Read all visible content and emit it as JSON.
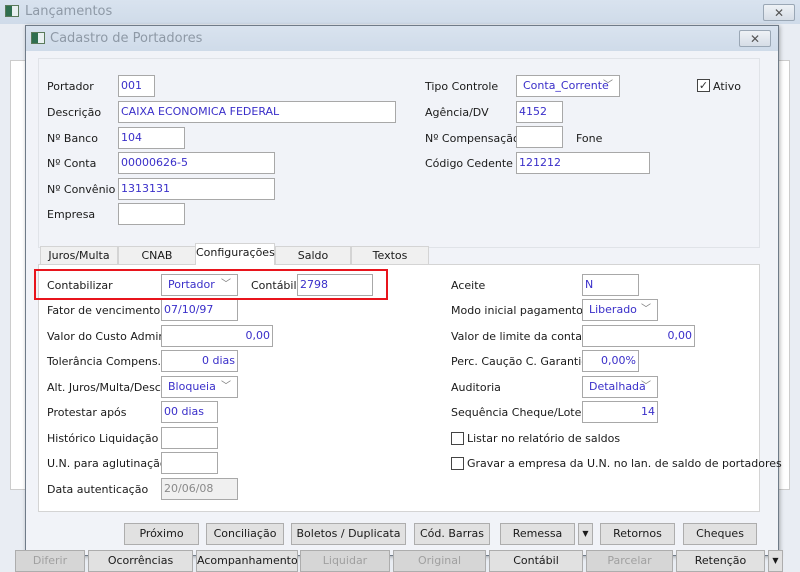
{
  "outer_window": {
    "title": "Lançamentos"
  },
  "dialog": {
    "title": "Cadastro de Portadores"
  },
  "header": {
    "portador": {
      "label": "Portador",
      "value": "001"
    },
    "descricao": {
      "label": "Descrição",
      "value": "CAIXA ECONOMICA FEDERAL"
    },
    "banco": {
      "label": "Nº Banco",
      "value": "104"
    },
    "conta": {
      "label": "Nº Conta",
      "value": "00000626-5"
    },
    "convenio": {
      "label": "Nº Convênio",
      "value": "1313131"
    },
    "empresa": {
      "label": "Empresa",
      "value": ""
    },
    "tipo_controle": {
      "label": "Tipo Controle",
      "value": "Conta_Corrente"
    },
    "agencia": {
      "label": "Agência/DV",
      "value": "4152"
    },
    "compensacao": {
      "label": "Nº Compensação",
      "value": ""
    },
    "fone": {
      "label": "Fone"
    },
    "cedente": {
      "label": "Código Cedente",
      "value": "121212"
    },
    "ativo": {
      "label": "Ativo",
      "checked": true
    }
  },
  "tabs": [
    {
      "label": "Juros/Multa"
    },
    {
      "label": "CNAB"
    },
    {
      "label": "Configurações",
      "active": true
    },
    {
      "label": "Saldo"
    },
    {
      "label": "Textos"
    }
  ],
  "config": {
    "contabilizar": {
      "label": "Contabilizar",
      "value": "Portador"
    },
    "contabil": {
      "label": "Contábil",
      "value": "2798"
    },
    "fator": {
      "label": "Fator de vencimento",
      "value": "07/10/97"
    },
    "custo": {
      "label": "Valor do Custo Admin.",
      "value": "0,00"
    },
    "tolerancia": {
      "label": "Tolerância Compens.",
      "value": "0 dias"
    },
    "alt_juros": {
      "label": "Alt. Juros/Multa/Desc.",
      "value": "Bloqueia"
    },
    "protestar": {
      "label": "Protestar após",
      "value": "00 dias"
    },
    "historico": {
      "label": "Histórico Liquidação",
      "value": ""
    },
    "un": {
      "label": "U.N. para aglutinação",
      "value": ""
    },
    "data_aut": {
      "label": "Data autenticação",
      "value": "20/06/08"
    },
    "aceite": {
      "label": "Aceite",
      "value": "N"
    },
    "modo": {
      "label": "Modo inicial pagamentos",
      "value": "Liberado"
    },
    "limite": {
      "label": "Valor de limite da conta",
      "value": "0,00"
    },
    "caucao": {
      "label": "Perc. Caução C. Garantida",
      "value": "0,00%"
    },
    "auditoria": {
      "label": "Auditoria",
      "value": "Detalhada"
    },
    "sequencia": {
      "label": "Sequência Cheque/Lote",
      "value": "14"
    },
    "listar": {
      "label": "Listar no relatório de saldos",
      "checked": false
    },
    "gravar": {
      "label": "Gravar a empresa da U.N. no lan. de saldo de portadores",
      "checked": false
    }
  },
  "dialog_buttons": [
    "Próximo",
    "Conciliação",
    "Boletos / Duplicata",
    "Cód. Barras",
    "Remessa",
    "Retornos",
    "Cheques"
  ],
  "outer_buttons": [
    "Diferir",
    "Ocorrências",
    "Acompanhamento",
    "Liquidar",
    "Original",
    "Contábil",
    "Parcelar",
    "Retenção"
  ],
  "highlight_color": "#e8141c"
}
